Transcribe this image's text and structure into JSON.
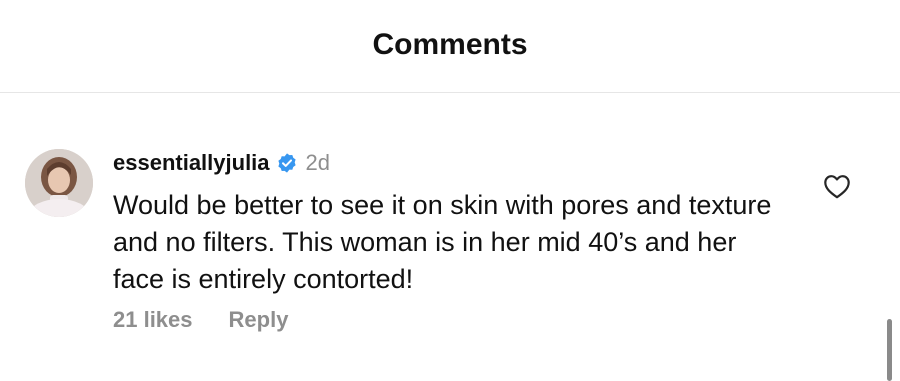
{
  "header": {
    "title": "Comments"
  },
  "comment": {
    "username": "essentiallyjulia",
    "verified_icon": "verified-badge-icon",
    "verified_color": "#3897f0",
    "time": "2d",
    "text": "Would be better to see it on skin with pores and texture and no filters. This woman is in her mid 40’s and her face is entirely contorted!",
    "likes": "21 likes",
    "reply_label": "Reply",
    "like_icon": "heart-outline-icon"
  }
}
